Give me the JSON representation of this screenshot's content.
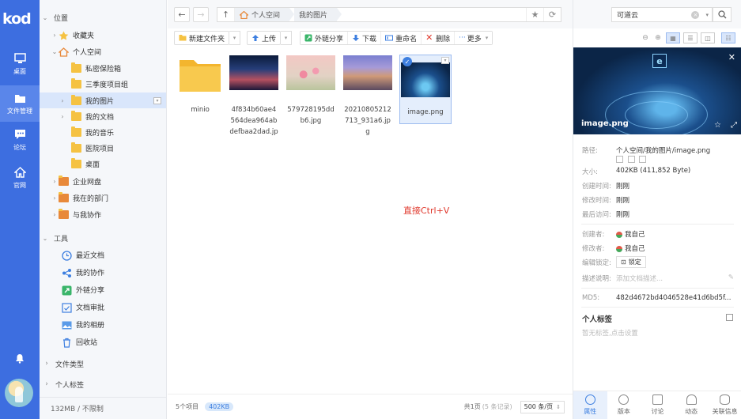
{
  "rail": {
    "logo": "kod",
    "items": [
      {
        "label": "桌面",
        "icon": "monitor-icon"
      },
      {
        "label": "文件管理",
        "icon": "folder-icon"
      },
      {
        "label": "论坛",
        "icon": "chat-icon"
      },
      {
        "label": "官网",
        "icon": "home-icon"
      }
    ]
  },
  "tree": {
    "sections": {
      "location": "位置",
      "tools": "工具",
      "file_types": "文件类型",
      "personal_tags": "个人标签"
    },
    "items": [
      "收藏夹",
      "个人空间",
      "私密保险箱",
      "三季度项目组",
      "我的图片",
      "我的文档",
      "我的音乐",
      "医院项目",
      "桌面",
      "企业网盘",
      "我在的部门",
      "与我协作"
    ],
    "tools": [
      "最近文档",
      "我的协作",
      "外链分享",
      "文档审批",
      "我的相册",
      "回收站"
    ],
    "footer": "132MB / 不限制"
  },
  "address": {
    "crumbs": [
      "个人空间",
      "我的图片"
    ]
  },
  "toolbar": {
    "new_folder": "新建文件夹",
    "upload": "上传",
    "share_link": "外链分享",
    "download": "下载",
    "rename": "重命名",
    "delete": "删除",
    "more": "更多"
  },
  "files": [
    {
      "name": "minio",
      "type": "folder"
    },
    {
      "name": "4f834b60ae4564dea964abdefbaa2dad.jp",
      "type": "image"
    },
    {
      "name": "579728195ddb6.jpg",
      "type": "image"
    },
    {
      "name": "20210805212713_931a6.jpg",
      "type": "image"
    },
    {
      "name": "image.png",
      "type": "image",
      "selected": true
    }
  ],
  "paste_hint": "直接Ctrl+V",
  "status": {
    "count": "5个项目",
    "size": "402KB",
    "page": "共1页",
    "records": "(5 条记录)",
    "per_page": "500 条/页"
  },
  "search": {
    "value": "可道云"
  },
  "preview": {
    "name": "image.png",
    "badge": "e"
  },
  "props": {
    "path_label": "路径:",
    "path_value": "个人空间/我的图片/image.png",
    "size_label": "大小:",
    "size_value": "402KB (411,852 Byte)",
    "created_label": "创建时间:",
    "created_value": "刚刚",
    "modified_label": "修改时间:",
    "modified_value": "刚刚",
    "accessed_label": "最后访问:",
    "accessed_value": "刚刚",
    "creator_label": "创建者:",
    "creator_value": "我自己",
    "modifier_label": "修改者:",
    "modifier_value": "我自己",
    "lock_label": "编辑锁定:",
    "lock_value": "锁定",
    "desc_label": "描述说明:",
    "desc_placeholder": "添加文档描述...",
    "md5_label": "MD5:",
    "md5_value": "482d4672bd4046528e41d6bd5f..."
  },
  "tags": {
    "title": "个人标签",
    "hint": "暂无标签,点击设置"
  },
  "right_tabs": [
    "属性",
    "版本",
    "讨论",
    "动态",
    "关联信息"
  ],
  "colors": {
    "rail": "#3d6ee0",
    "accent": "#3d7fe0",
    "paste_hint": "#e0392d"
  }
}
